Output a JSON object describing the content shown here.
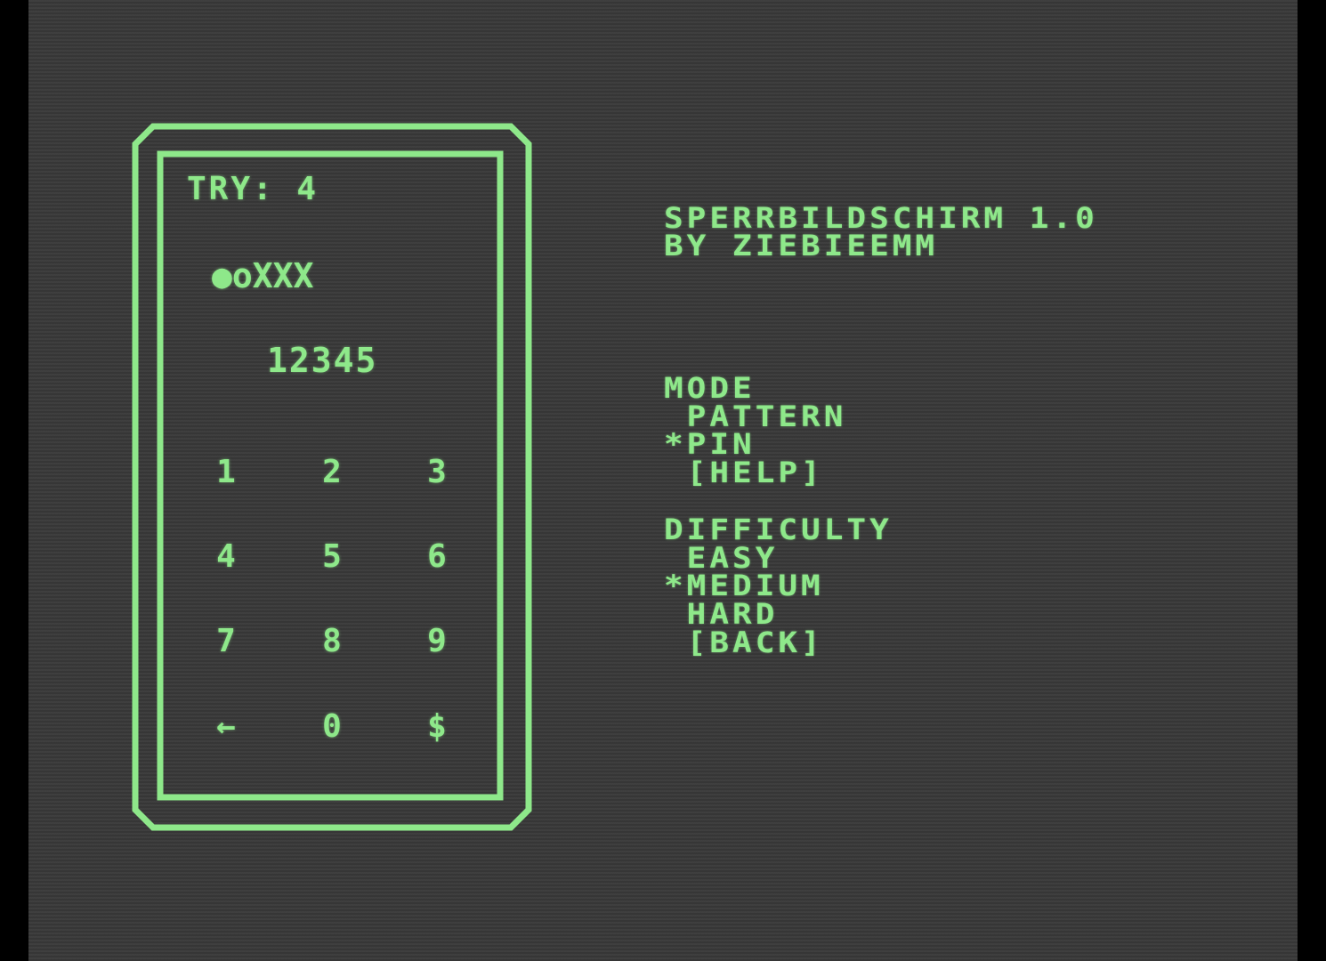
{
  "colors": {
    "background": "#3a3a3a",
    "border": "#000000",
    "foreground": "#8ee88a"
  },
  "phone": {
    "try_label": "TRY: 4",
    "attempt_indicators": "●oXXX",
    "pin_entry": "12345",
    "keypad": [
      [
        "1",
        "2",
        "3"
      ],
      [
        "4",
        "5",
        "6"
      ],
      [
        "7",
        "8",
        "9"
      ],
      [
        "←",
        "0",
        "$"
      ]
    ]
  },
  "title": {
    "line1": "SPERRBILDSCHIRM 1.0",
    "line2": "BY ZIEBIEEMM"
  },
  "mode_menu": {
    "heading": "MODE",
    "items": [
      " PATTERN",
      "*PIN",
      " [HELP]"
    ]
  },
  "difficulty_menu": {
    "heading": "DIFFICULTY",
    "items": [
      " EASY",
      "*MEDIUM",
      " HARD",
      " [BACK]"
    ]
  }
}
